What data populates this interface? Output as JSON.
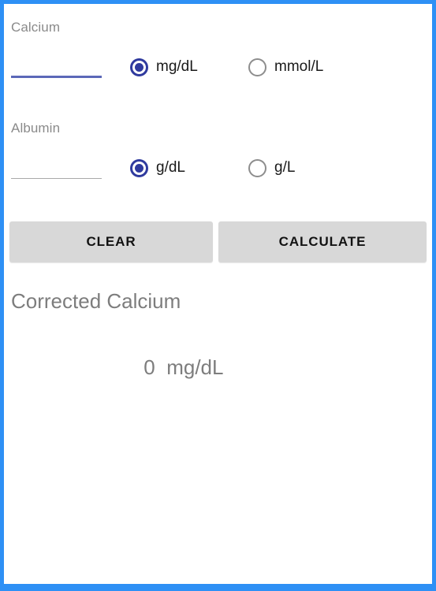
{
  "window": {
    "frame_color": "#2e90f5",
    "background_color": "#ffffff"
  },
  "theme": {
    "accent_selected_radio": "#2f3a9e",
    "unselected_radio": "#8d8d8d",
    "focused_underline": "#5b68b8",
    "idle_underline": "#a9a9a9",
    "button_background": "#d8d8d8",
    "muted_text": "#7d7d7d",
    "label_text": "#8a8a8a"
  },
  "calcium": {
    "label": "Calcium",
    "input_value": "",
    "input_placeholder": "",
    "units": [
      {
        "label": "mg/dL",
        "selected": true,
        "icon": "radio-selected-icon"
      },
      {
        "label": "mmol/L",
        "selected": false,
        "icon": "radio-unselected-icon"
      }
    ]
  },
  "albumin": {
    "label": "Albumin",
    "input_value": "",
    "input_placeholder": "",
    "units": [
      {
        "label": "g/dL",
        "selected": true,
        "icon": "radio-selected-icon"
      },
      {
        "label": "g/L",
        "selected": false,
        "icon": "radio-unselected-icon"
      }
    ]
  },
  "buttons": {
    "clear_label": "CLEAR",
    "calculate_label": "CALCULATE"
  },
  "result": {
    "title": "Corrected Calcium",
    "value": "0",
    "unit": "mg/dL",
    "separator": "  "
  }
}
